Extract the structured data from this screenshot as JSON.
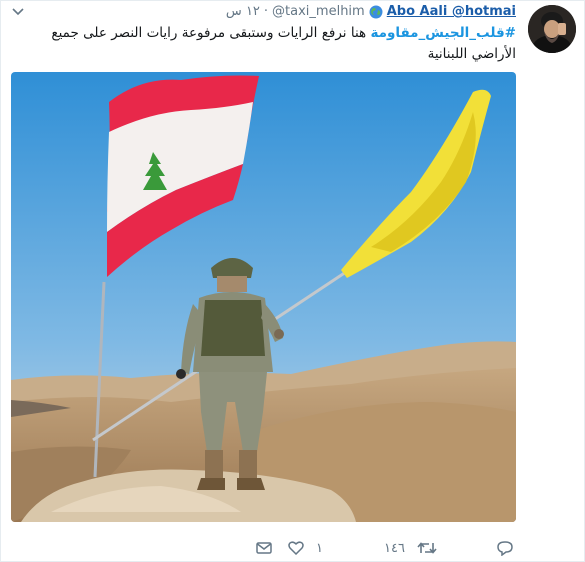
{
  "author": {
    "display_name": "Abo Aali @hotmai",
    "handle": "@taxi_melhim",
    "time": "١٢ س"
  },
  "tweet": {
    "hashtag": "#قلب_الجيش_مقاومة",
    "text": " هنا نرفع الرايات وستبقى مرفوعة رايات النصر على جميع الأراضي اللبنانية"
  },
  "actions": {
    "replies": "",
    "retweets": "١٤٦",
    "likes": "١"
  },
  "icons": {
    "caret": "chevron-down-icon",
    "globe": "globe-icon",
    "reply": "reply-icon",
    "retweet": "retweet-icon",
    "like": "heart-icon",
    "message": "envelope-icon"
  },
  "colors": {
    "link": "#1b5da9",
    "hashtag": "#1b95e0",
    "muted": "#657786"
  }
}
